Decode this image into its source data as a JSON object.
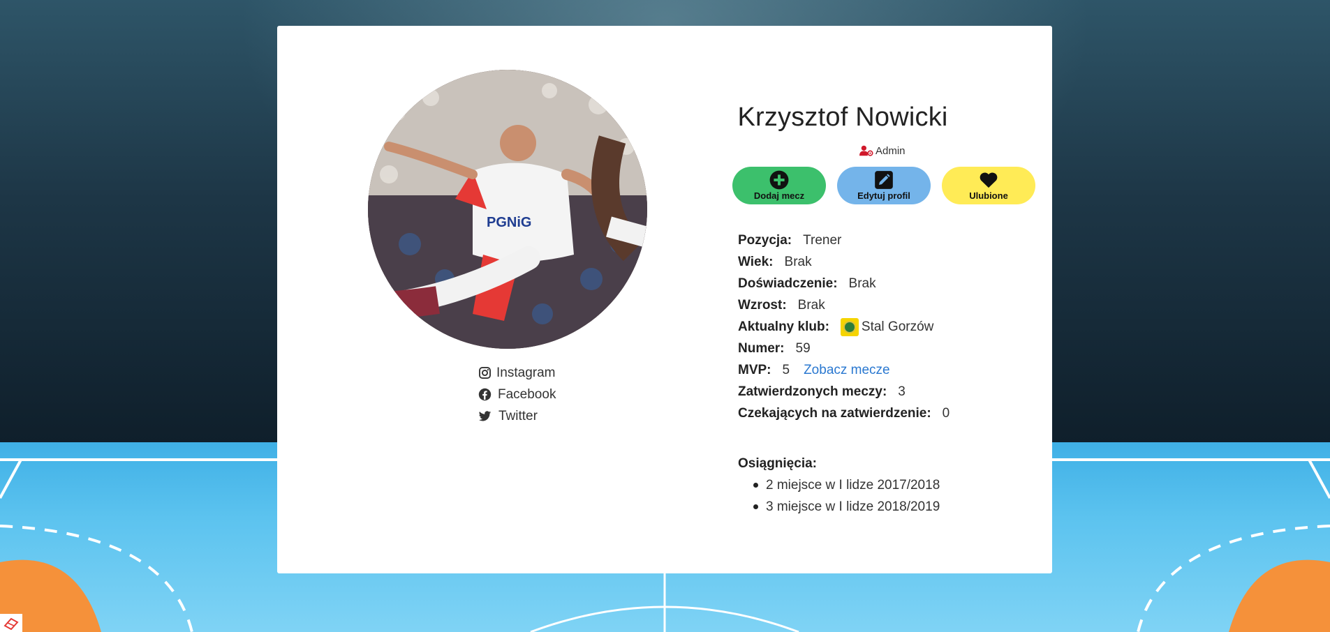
{
  "profile": {
    "name": "Krzysztof Nowicki",
    "role": "Admin",
    "photo_alt": "",
    "socials": [
      {
        "label": "Instagram",
        "icon": "instagram-icon"
      },
      {
        "label": "Facebook",
        "icon": "facebook-icon"
      },
      {
        "label": "Twitter",
        "icon": "twitter-icon"
      }
    ]
  },
  "actions": [
    {
      "label": "Dodaj mecz",
      "icon": "plus-circle-icon",
      "color": "#3cc06c"
    },
    {
      "label": "Edytuj profil",
      "icon": "edit-icon",
      "color": "#74b4ea"
    },
    {
      "label": "Ulubione",
      "icon": "heart-icon",
      "color": "#ffeb56"
    }
  ],
  "info": {
    "position": {
      "label": "Pozycja:",
      "value": "Trener"
    },
    "age": {
      "label": "Wiek:",
      "value": "Brak"
    },
    "experience": {
      "label": "Doświadczenie:",
      "value": "Brak"
    },
    "height": {
      "label": "Wzrost:",
      "value": "Brak"
    },
    "club": {
      "label": "Aktualny klub:",
      "value": "Stal Gorzów"
    },
    "number": {
      "label": "Numer:",
      "value": "59"
    },
    "mvp": {
      "label": "MVP:",
      "value": "5",
      "link": "Zobacz mecze"
    },
    "approved": {
      "label": "Zatwierdzonych meczy:",
      "value": "3"
    },
    "pending": {
      "label": "Czekających na zatwierdzenie:",
      "value": "0"
    }
  },
  "achievements": {
    "title": "Osiągnięcia:",
    "items": [
      "2 miejsce w I lidze 2017/2018",
      "3 miejsce w I lidze 2018/2019"
    ]
  },
  "colors": {
    "link": "#2a78d0",
    "admin_icon": "#d0192b"
  }
}
